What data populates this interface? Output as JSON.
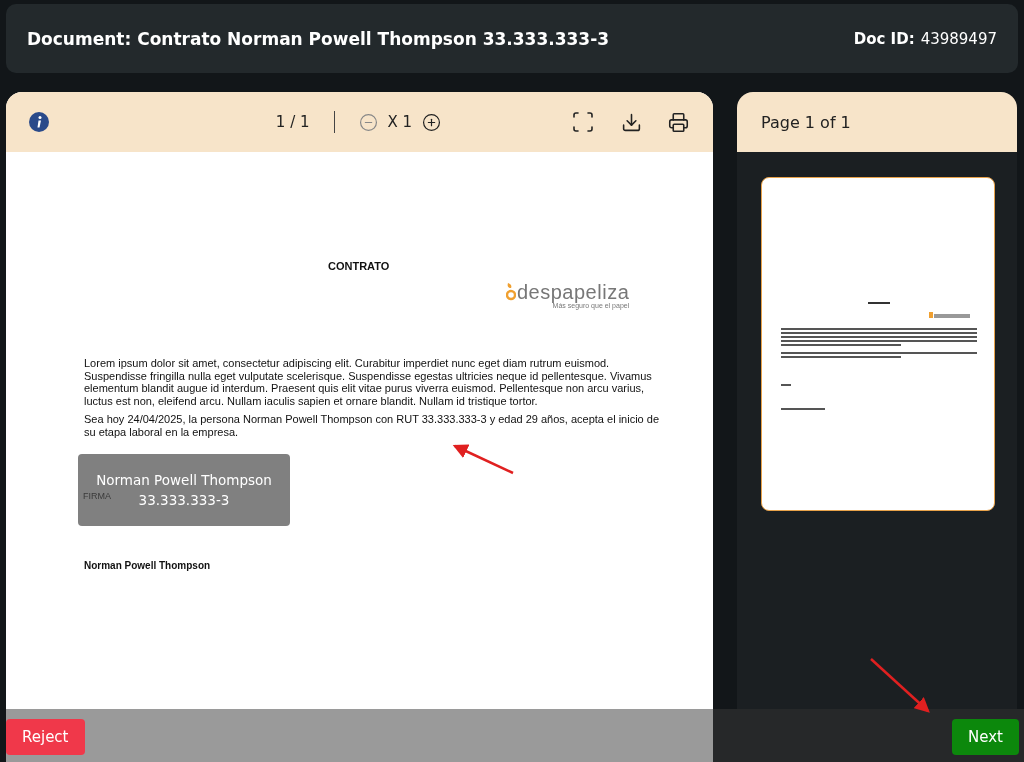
{
  "header": {
    "title": "Document: Contrato Norman Powell Thompson 33.333.333-3",
    "doc_id_label": "Doc ID:",
    "doc_id": "43989497"
  },
  "viewer": {
    "page_indicator": "1 / 1",
    "zoom": "X 1",
    "document": {
      "title": "CONTRATO",
      "logo": {
        "name": "despapeliza",
        "tagline": "Más seguro que el papel"
      },
      "paragraphs": [
        "Lorem ipsum dolor sit amet, consectetur adipiscing elit. Curabitur imperdiet nunc eget diam rutrum euismod. Suspendisse fringilla nulla eget vulputate scelerisque. Suspendisse egestas ultricies neque id pellentesque. Vivamus elementum blandit augue id interdum. Praesent quis elit vitae purus viverra euismod. Pellentesque non arcu varius, luctus est non, eleifend arcu. Nullam iaculis sapien et ornare blandit. Nullam id tristique tortor.",
        "Sea hoy 24/04/2025, la persona Norman Powell Thompson con RUT 33.333.333-3 y edad 29 años, acepta el inicio de su etapa laboral en la empresa."
      ],
      "signature": {
        "label": "FIRMA",
        "name": "Norman Powell Thompson",
        "rut": "33.333.333-3"
      },
      "signer_name": "Norman Powell Thompson"
    }
  },
  "pages_panel": {
    "title": "Page 1 of 1",
    "thumbnails": [
      {
        "selected": true
      }
    ]
  },
  "actions": [
    {
      "label": "Reject",
      "kind": "reject"
    },
    {
      "label": "Next",
      "kind": "next"
    }
  ]
}
